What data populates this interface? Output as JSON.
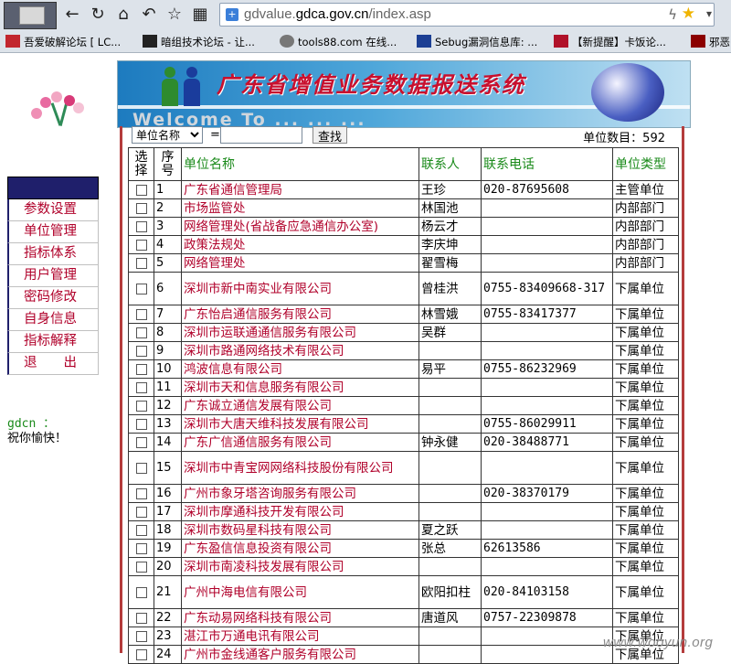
{
  "browser": {
    "url_prefix": "gdvalue.",
    "url_domain": "gdca.gov.cn",
    "url_path": "/index.asp",
    "bookmarks": [
      {
        "label": "吾爱破解论坛 [ LC..."
      },
      {
        "label": "暗组技术论坛 - 让..."
      },
      {
        "label": "tools88.com 在线..."
      },
      {
        "label": "Sebug漏洞信息库: ..."
      },
      {
        "label": "【新提醒】卡饭论..."
      },
      {
        "label": "邪恶"
      }
    ]
  },
  "banner": {
    "title": "广东省增值业务数据报送系统",
    "welcome": "Welcome To  ... ... ..."
  },
  "sidebar": {
    "items": [
      {
        "label": "参数设置"
      },
      {
        "label": "单位管理"
      },
      {
        "label": "指标体系"
      },
      {
        "label": "用户管理"
      },
      {
        "label": "密码修改"
      },
      {
        "label": "自身信息"
      },
      {
        "label": "指标解释"
      },
      {
        "label": "退　　出"
      }
    ]
  },
  "greeting": {
    "user": "gdcn ：",
    "message": "祝你愉快！"
  },
  "search": {
    "field_label": "单位名称",
    "equals": "=",
    "input_value": "",
    "button": "查找",
    "count_label": "单位数目：592"
  },
  "table": {
    "headers": {
      "select": "选择",
      "no": "序号",
      "name": "单位名称",
      "contact": "联系人",
      "phone": "联系电话",
      "type": "单位类型"
    },
    "rows": [
      {
        "no": "1",
        "name": "广东省通信管理局",
        "contact": "王珍",
        "phone": "020-87695608",
        "type": "主管单位"
      },
      {
        "no": "2",
        "name": "市场监管处",
        "contact": "林国池",
        "phone": "",
        "type": "内部部门"
      },
      {
        "no": "3",
        "name": "网络管理处(省战备应急通信办公室)",
        "contact": "杨云才",
        "phone": "",
        "type": "内部部门"
      },
      {
        "no": "4",
        "name": "政策法规处",
        "contact": "李庆坤",
        "phone": "",
        "type": "内部部门"
      },
      {
        "no": "5",
        "name": "网络管理处",
        "contact": "翟雪梅",
        "phone": "",
        "type": "内部部门"
      },
      {
        "no": "6",
        "name": "深圳市新中南实业有限公司",
        "contact": "曾桂洪",
        "phone": "0755-83409668-317",
        "type": "下属单位",
        "tall": true
      },
      {
        "no": "7",
        "name": "广东怡启通信服务有限公司",
        "contact": "林雪娥",
        "phone": "0755-83417377",
        "type": "下属单位"
      },
      {
        "no": "8",
        "name": "深圳市运联通通信服务有限公司",
        "contact": "吴群",
        "phone": "",
        "type": "下属单位"
      },
      {
        "no": "9",
        "name": "深圳市路通网络技术有限公司",
        "contact": "",
        "phone": "",
        "type": "下属单位"
      },
      {
        "no": "10",
        "name": "鸿波信息有限公司",
        "contact": "易平",
        "phone": "0755-86232969",
        "type": "下属单位"
      },
      {
        "no": "11",
        "name": "深圳市天和信息服务有限公司",
        "contact": "",
        "phone": "",
        "type": "下属单位"
      },
      {
        "no": "12",
        "name": "广东诚立通信发展有限公司",
        "contact": "",
        "phone": "",
        "type": "下属单位"
      },
      {
        "no": "13",
        "name": "深圳市大唐天维科技发展有限公司",
        "contact": "",
        "phone": "0755-86029911",
        "type": "下属单位"
      },
      {
        "no": "14",
        "name": "广东广信通信服务有限公司",
        "contact": "钟永健",
        "phone": "020-38488771",
        "type": "下属单位"
      },
      {
        "no": "15",
        "name": "深圳市中青宝网网络科技股份有限公司",
        "contact": "",
        "phone": "",
        "type": "下属单位",
        "tall": true
      },
      {
        "no": "16",
        "name": "广州市象牙塔咨询服务有限公司",
        "contact": "",
        "phone": "020-38370179",
        "type": "下属单位"
      },
      {
        "no": "17",
        "name": "深圳市摩通科技开发有限公司",
        "contact": "",
        "phone": "",
        "type": "下属单位"
      },
      {
        "no": "18",
        "name": "深圳市数码星科技有限公司",
        "contact": "夏之跃",
        "phone": "",
        "type": "下属单位"
      },
      {
        "no": "19",
        "name": "广东盈信信息投资有限公司",
        "contact": "张总",
        "phone": "62613586",
        "type": "下属单位"
      },
      {
        "no": "20",
        "name": "深圳市南凌科技发展有限公司",
        "contact": "",
        "phone": "",
        "type": "下属单位"
      },
      {
        "no": "21",
        "name": "广州中海电信有限公司",
        "contact": "欧阳扣柱",
        "phone": "020-84103158",
        "type": "下属单位",
        "tall": true
      },
      {
        "no": "22",
        "name": "广东动易网络科技有限公司",
        "contact": "唐道风",
        "phone": "0757-22309878",
        "type": "下属单位"
      },
      {
        "no": "23",
        "name": "湛江市万通电讯有限公司",
        "contact": "",
        "phone": "",
        "type": "下属单位"
      },
      {
        "no": "24",
        "name": "广州市金线通客户服务有限公司",
        "contact": "",
        "phone": "",
        "type": "下属单位"
      }
    ]
  },
  "watermark": "www.wooyun.org"
}
